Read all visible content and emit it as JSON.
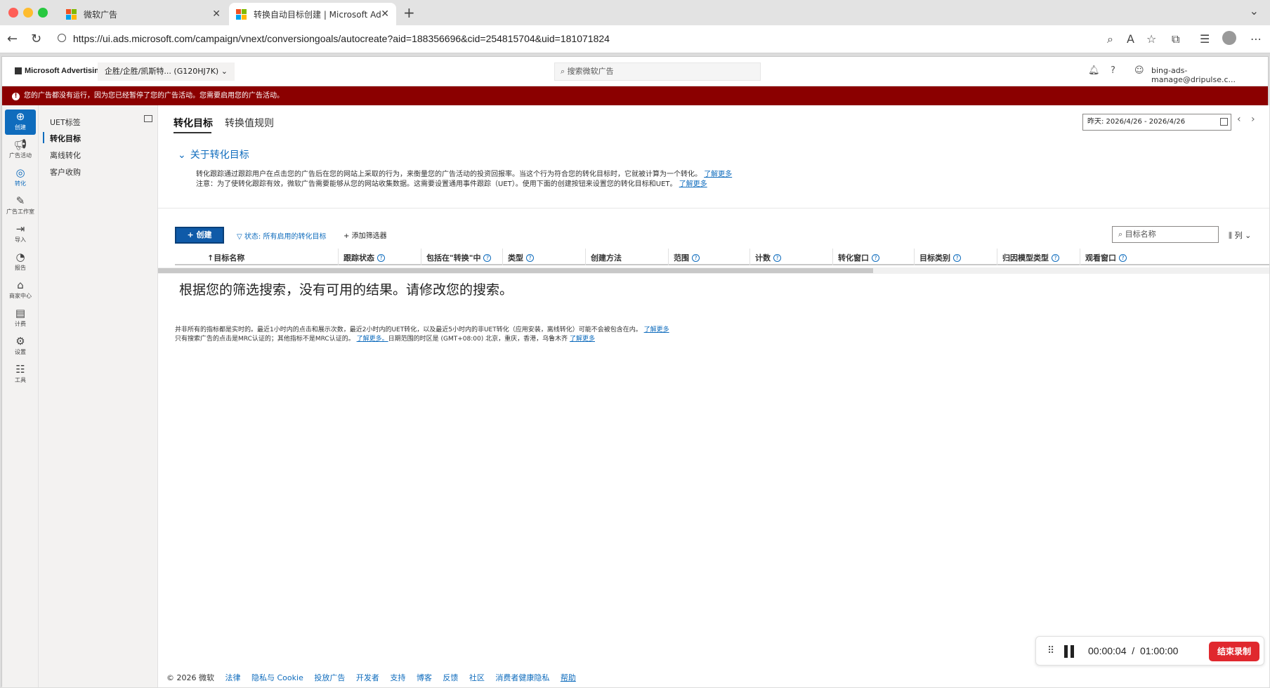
{
  "browser": {
    "tabs": [
      {
        "title": "微软广告",
        "active": false
      },
      {
        "title": "转换自动目标创建 | Microsoft Ad",
        "active": true
      }
    ],
    "url": "https://ui.ads.microsoft.com/campaign/vnext/conversiongoals/autocreate?aid=188356696&cid=254815704&uid=181071824",
    "colors": {
      "close": "#ff5f57",
      "minimize": "#febc2e",
      "maximize": "#28c840"
    }
  },
  "header": {
    "brand": "Microsoft Advertising",
    "account": "企胜/企胜/凯斯特... (G120HJ7K)",
    "search_placeholder": "搜索微软广告",
    "user_email": "bing-ads-manage@dripulse.c..."
  },
  "banner": {
    "text": "您的广告都没有运行，因为您已经暂停了您的广告活动。您需要启用您的广告活动。",
    "color": "#8b0000"
  },
  "rail": {
    "items": [
      {
        "label": "创建",
        "icon": "plus-circle-icon"
      },
      {
        "label": "广告活动",
        "icon": "megaphone-icon"
      },
      {
        "label": "转化",
        "icon": "target-icon"
      },
      {
        "label": "广告工作室",
        "icon": "edit-icon"
      },
      {
        "label": "导入",
        "icon": "import-icon"
      },
      {
        "label": "报告",
        "icon": "report-icon"
      },
      {
        "label": "商家中心",
        "icon": "shop-icon"
      },
      {
        "label": "计费",
        "icon": "billing-icon"
      },
      {
        "label": "设置",
        "icon": "gear-icon"
      },
      {
        "label": "工具",
        "icon": "tools-icon"
      }
    ]
  },
  "subnav": {
    "title": "UET标签",
    "items": [
      "转化目标",
      "离线转化",
      "客户收购"
    ]
  },
  "main": {
    "tabs": [
      "转化目标",
      "转换值规则"
    ],
    "date_range": "昨天: 2026/4/26 - 2026/4/26",
    "about_title": "关于转化目标",
    "desc_line1": "转化跟踪通过跟踪用户在点击您的广告后在您的网站上采取的行为，来衡量您的广告活动的投资回报率。当这个行为符合您的转化目标时，它就被计算为一个转化。",
    "desc_line2": "注意：为了使转化跟踪有效，微软广告需要能够从您的网站收集数据。这需要设置通用事件跟踪（UET）。使用下面的创建按钮来设置您的转化目标和UET。",
    "learn_more": "了解更多",
    "create_label": "创建",
    "filter_label": "状态: 所有启用的转化目标",
    "add_filter_label": "添加筛选器",
    "goal_search_placeholder": "目标名称",
    "columns_label": "列",
    "columns": [
      "目标名称",
      "跟踪状态",
      "包括在\"转换\"中",
      "类型",
      "创建方法",
      "范围",
      "计数",
      "转化窗口",
      "目标类别",
      "归因模型类型",
      "观看窗口"
    ],
    "no_results": "根据您的筛选搜索，没有可用的结果。请修改您的搜索。",
    "footnote1": "并非所有的指标都是实时的。最近1小时内的点击和展示次数，最近2小时内的UET转化，以及最近5小时内的非UET转化（应用安装，离线转化）可能不会被包含在内。",
    "footnote1_link": "了解更多",
    "footnote2a": "只有搜索广告的点击是MRC认证的；其他指标不是MRC认证的。",
    "footnote2_link1": "了解更多。",
    "footnote2b": "日期范围的时区是 (GMT+08:00) 北京，重庆，香港，乌鲁木齐",
    "footnote2_link2": "了解更多"
  },
  "footer": {
    "copyright": "© 2026 微软",
    "links": [
      "法律",
      "隐私与 Cookie",
      "投放广告",
      "开发者",
      "支持",
      "博客",
      "反馈",
      "社区",
      "消费者健康隐私",
      "帮助"
    ]
  },
  "recorder": {
    "elapsed": "00:00:04",
    "separator": "/",
    "limit": "01:00:00",
    "end_label": "结束录制"
  }
}
